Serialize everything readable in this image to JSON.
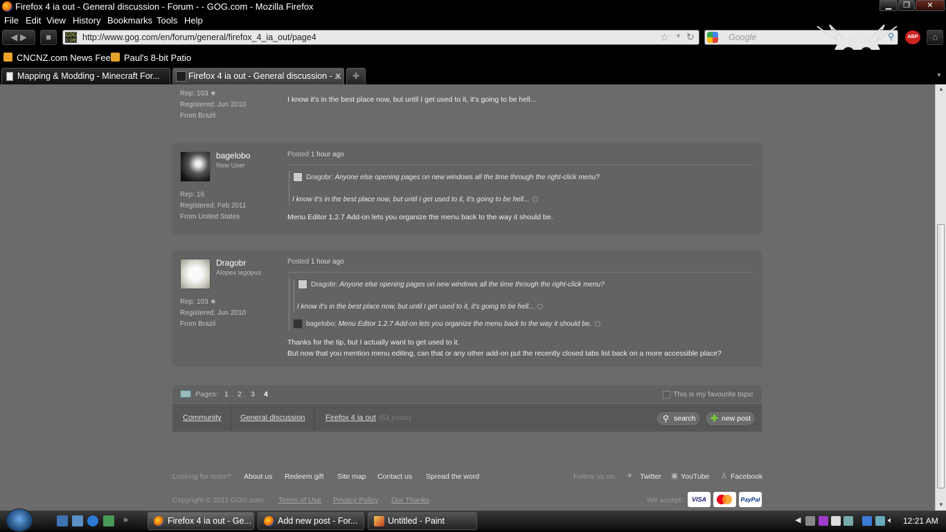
{
  "window": {
    "title": "Firefox 4 ia out - General discussion - Forum - - GOG.com - Mozilla Firefox",
    "minimize": "▁",
    "maximize": "❐",
    "close": "✕"
  },
  "menu": [
    "File",
    "Edit",
    "View",
    "History",
    "Bookmarks",
    "Tools",
    "Help"
  ],
  "nav": {
    "url": "http://www.gog.com/en/forum/general/firefox_4_ia_out/page4",
    "favicon": "GOG com",
    "search_placeholder": "Google"
  },
  "bookmarks": [
    {
      "label": "CNCNZ.com News Feed",
      "icon": "rss-icon"
    },
    {
      "label": "Paul's 8-bit Patio",
      "icon": "rss-icon"
    }
  ],
  "tabs": [
    {
      "label": "Mapping & Modding - Minecraft For...",
      "active": false
    },
    {
      "label": "Firefox 4 ia out - General discussion - ...",
      "active": true
    }
  ],
  "posts": {
    "prev": {
      "rep": "Rep: 103",
      "registered": "Registered: Jun 2010",
      "from": "From Brazil",
      "body": "I know it's in the best place now, but until I get used to it, it's going to be hell..."
    },
    "p1": {
      "username": "bagelobo",
      "rank": "New User",
      "rep": "Rep: 16",
      "registered": "Registered: Feb 2011",
      "from": "From United States",
      "posted_label": "Posted",
      "posted_time": "1 hour ago",
      "quote_author": "Dragobr:",
      "quote_line1": "Anyone else opening pages on new windows all the time through the right-click menu?",
      "quote_line2": "I know it's in the best place now, but until I get used to it, it's going to be hell...",
      "body": "Menu Editor 1.2.7 Add-on lets you organize the menu back to the way it should be."
    },
    "p2": {
      "username": "Dragobr",
      "rank": "Alopex lagopus",
      "rep": "Rep: 103",
      "registered": "Registered: Jun 2010",
      "from": "From Brazil",
      "posted_label": "Posted",
      "posted_time": "1 hour ago",
      "quote_author": "Dragobr:",
      "quote_line1": "Anyone else opening pages on new windows all the time through the right-click menu?",
      "quote_line2": "I know it's in the best place now, but until I get used to it, it's going to be hell...",
      "quote2_author": "bagelobo:",
      "quote2_line": "Menu Editor 1.2.7 Add-on lets you organize the menu back to the way it should be.",
      "body_line1": "Thanks for the tip, but I actually want to get used to it.",
      "body_line2": "But now that you mention menu editing, can that or any other add-on put the recently closed tabs list back on a more accessible place?"
    }
  },
  "pager": {
    "label": "Pages:",
    "pages": [
      "1",
      "2",
      "3",
      "4"
    ],
    "current": "4",
    "favourite": "This is my favourite topic"
  },
  "breadcrumb": {
    "items": [
      "Community",
      "General discussion",
      "Firefox 4 ia out"
    ],
    "count": "(63 posts)",
    "search": "search",
    "new_post": "new post"
  },
  "footer": {
    "looking": "Looking for more?",
    "links": [
      "About us",
      "Redeem gift",
      "Site map",
      "Contact us",
      "Spread the word"
    ],
    "follow": "Follow us on:",
    "social": [
      "Twitter",
      "YouTube",
      "Facebook"
    ],
    "copyright": "Copyright © 2011 GOG.com.",
    "legal": [
      "Terms of Use",
      "Privacy Policy",
      "Our Thanks"
    ],
    "accept": "We accept:",
    "cards": [
      "VISA",
      "MasterCard",
      "PayPal"
    ]
  },
  "taskbar": {
    "apps": [
      "Firefox 4 ia out - Ge...",
      "Add new post - For...",
      "Untitled - Paint"
    ],
    "clock": "12:21 AM"
  },
  "colors": {
    "page_bg": "#6b6b6b",
    "post_bg": "#636363",
    "chrome": "#000000",
    "addon_abp": "#cc2222"
  }
}
